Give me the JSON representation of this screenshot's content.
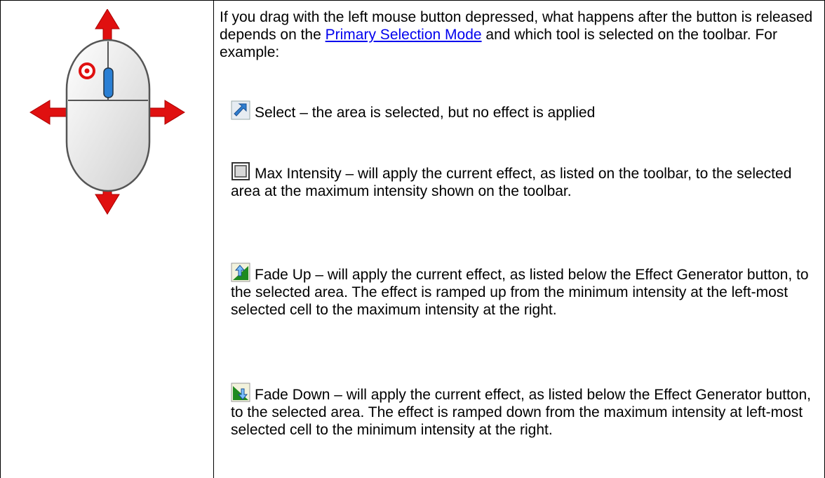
{
  "intro": {
    "before_link": "If you drag with the left mouse button depressed, what happens after the button is released depends on the ",
    "link_text": "Primary Selection Mode",
    "after_link": " and which tool is selected on the toolbar. For example:"
  },
  "items": [
    {
      "icon": "select-arrow-icon",
      "text": "Select – the area is selected, but no effect is applied"
    },
    {
      "icon": "max-intensity-square-icon",
      "text": "Max Intensity – will apply the current effect, as listed on the toolbar, to the selected area at the maximum intensity shown on the toolbar."
    },
    {
      "icon": "fade-up-icon",
      "text": "Fade Up – will apply the current effect, as listed below the Effect Generator button, to the selected area. The effect is ramped up from the minimum intensity at the left-most selected cell to the maximum intensity at the right."
    },
    {
      "icon": "fade-down-icon",
      "text": "Fade Down – will apply the current effect, as listed below the Effect Generator button, to the selected area. The effect is ramped down from the maximum intensity at left-most selected cell to the minimum intensity at the right."
    }
  ],
  "left_icon": "mouse-drag-icon",
  "colors": {
    "arrow": "#e01010",
    "link": "#0000ee",
    "scroll_wheel": "#2a7fd4"
  }
}
